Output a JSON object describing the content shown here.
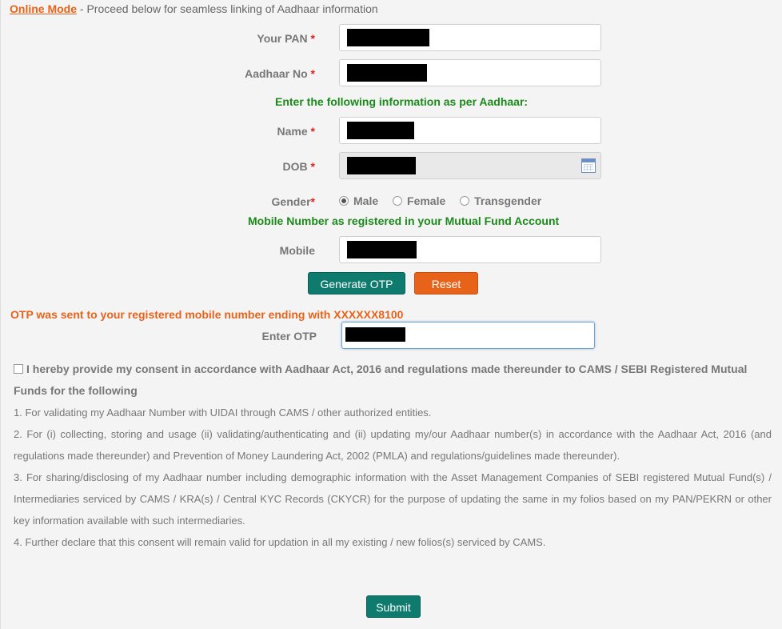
{
  "intro": {
    "mode_link": "Online Mode",
    "text": " - Proceed below for seamless linking of Aadhaar information"
  },
  "form": {
    "pan_label": "Your PAN",
    "aadhaar_label": "Aadhaar No",
    "aadhaar_heading": "Enter the following information as per Aadhaar:",
    "name_label": "Name",
    "dob_label": "DOB",
    "gender_label": "Gender",
    "required_mark": "*",
    "gender_options": [
      "Male",
      "Female",
      "Transgender"
    ],
    "gender_selected": "Male",
    "mobile_heading": "Mobile Number as registered in your Mutual Fund Account",
    "mobile_label": "Mobile",
    "otp_label": "Enter OTP"
  },
  "buttons": {
    "generate_otp": "Generate OTP",
    "reset": "Reset",
    "submit": "Submit"
  },
  "otp_message": "OTP was sent to your registered mobile number ending with XXXXXX8100",
  "consent": {
    "heading": "I hereby provide my consent in accordance with Aadhaar Act, 2016 and regulations made thereunder to CAMS / SEBI Registered Mutual Funds for the following",
    "items": [
      "1. For validating my Aadhaar Number with UIDAI through CAMS / other authorized entities.",
      "2. For (i) collecting, storing and usage (ii) validating/authenticating and (ii) updating my/our Aadhaar number(s) in accordance with the Aadhaar Act, 2016 (and regulations made thereunder) and Prevention of Money Laundering Act, 2002 (PMLA) and regulations/guidelines made thereunder).",
      "3. For sharing/disclosing of my Aadhaar number including demographic information with the Asset Management Companies of SEBI registered Mutual Fund(s) / Intermediaries serviced by CAMS / KRA(s) / Central KYC Records (CKYCR) for the purpose of updating the same in my folios based on my PAN/PEKRN or other key information available with such intermediaries.",
      "4. Further declare that this consent will remain valid for updation in all my existing / new folios(s) serviced by CAMS."
    ]
  },
  "icons": {
    "calendar": "calendar-icon"
  }
}
